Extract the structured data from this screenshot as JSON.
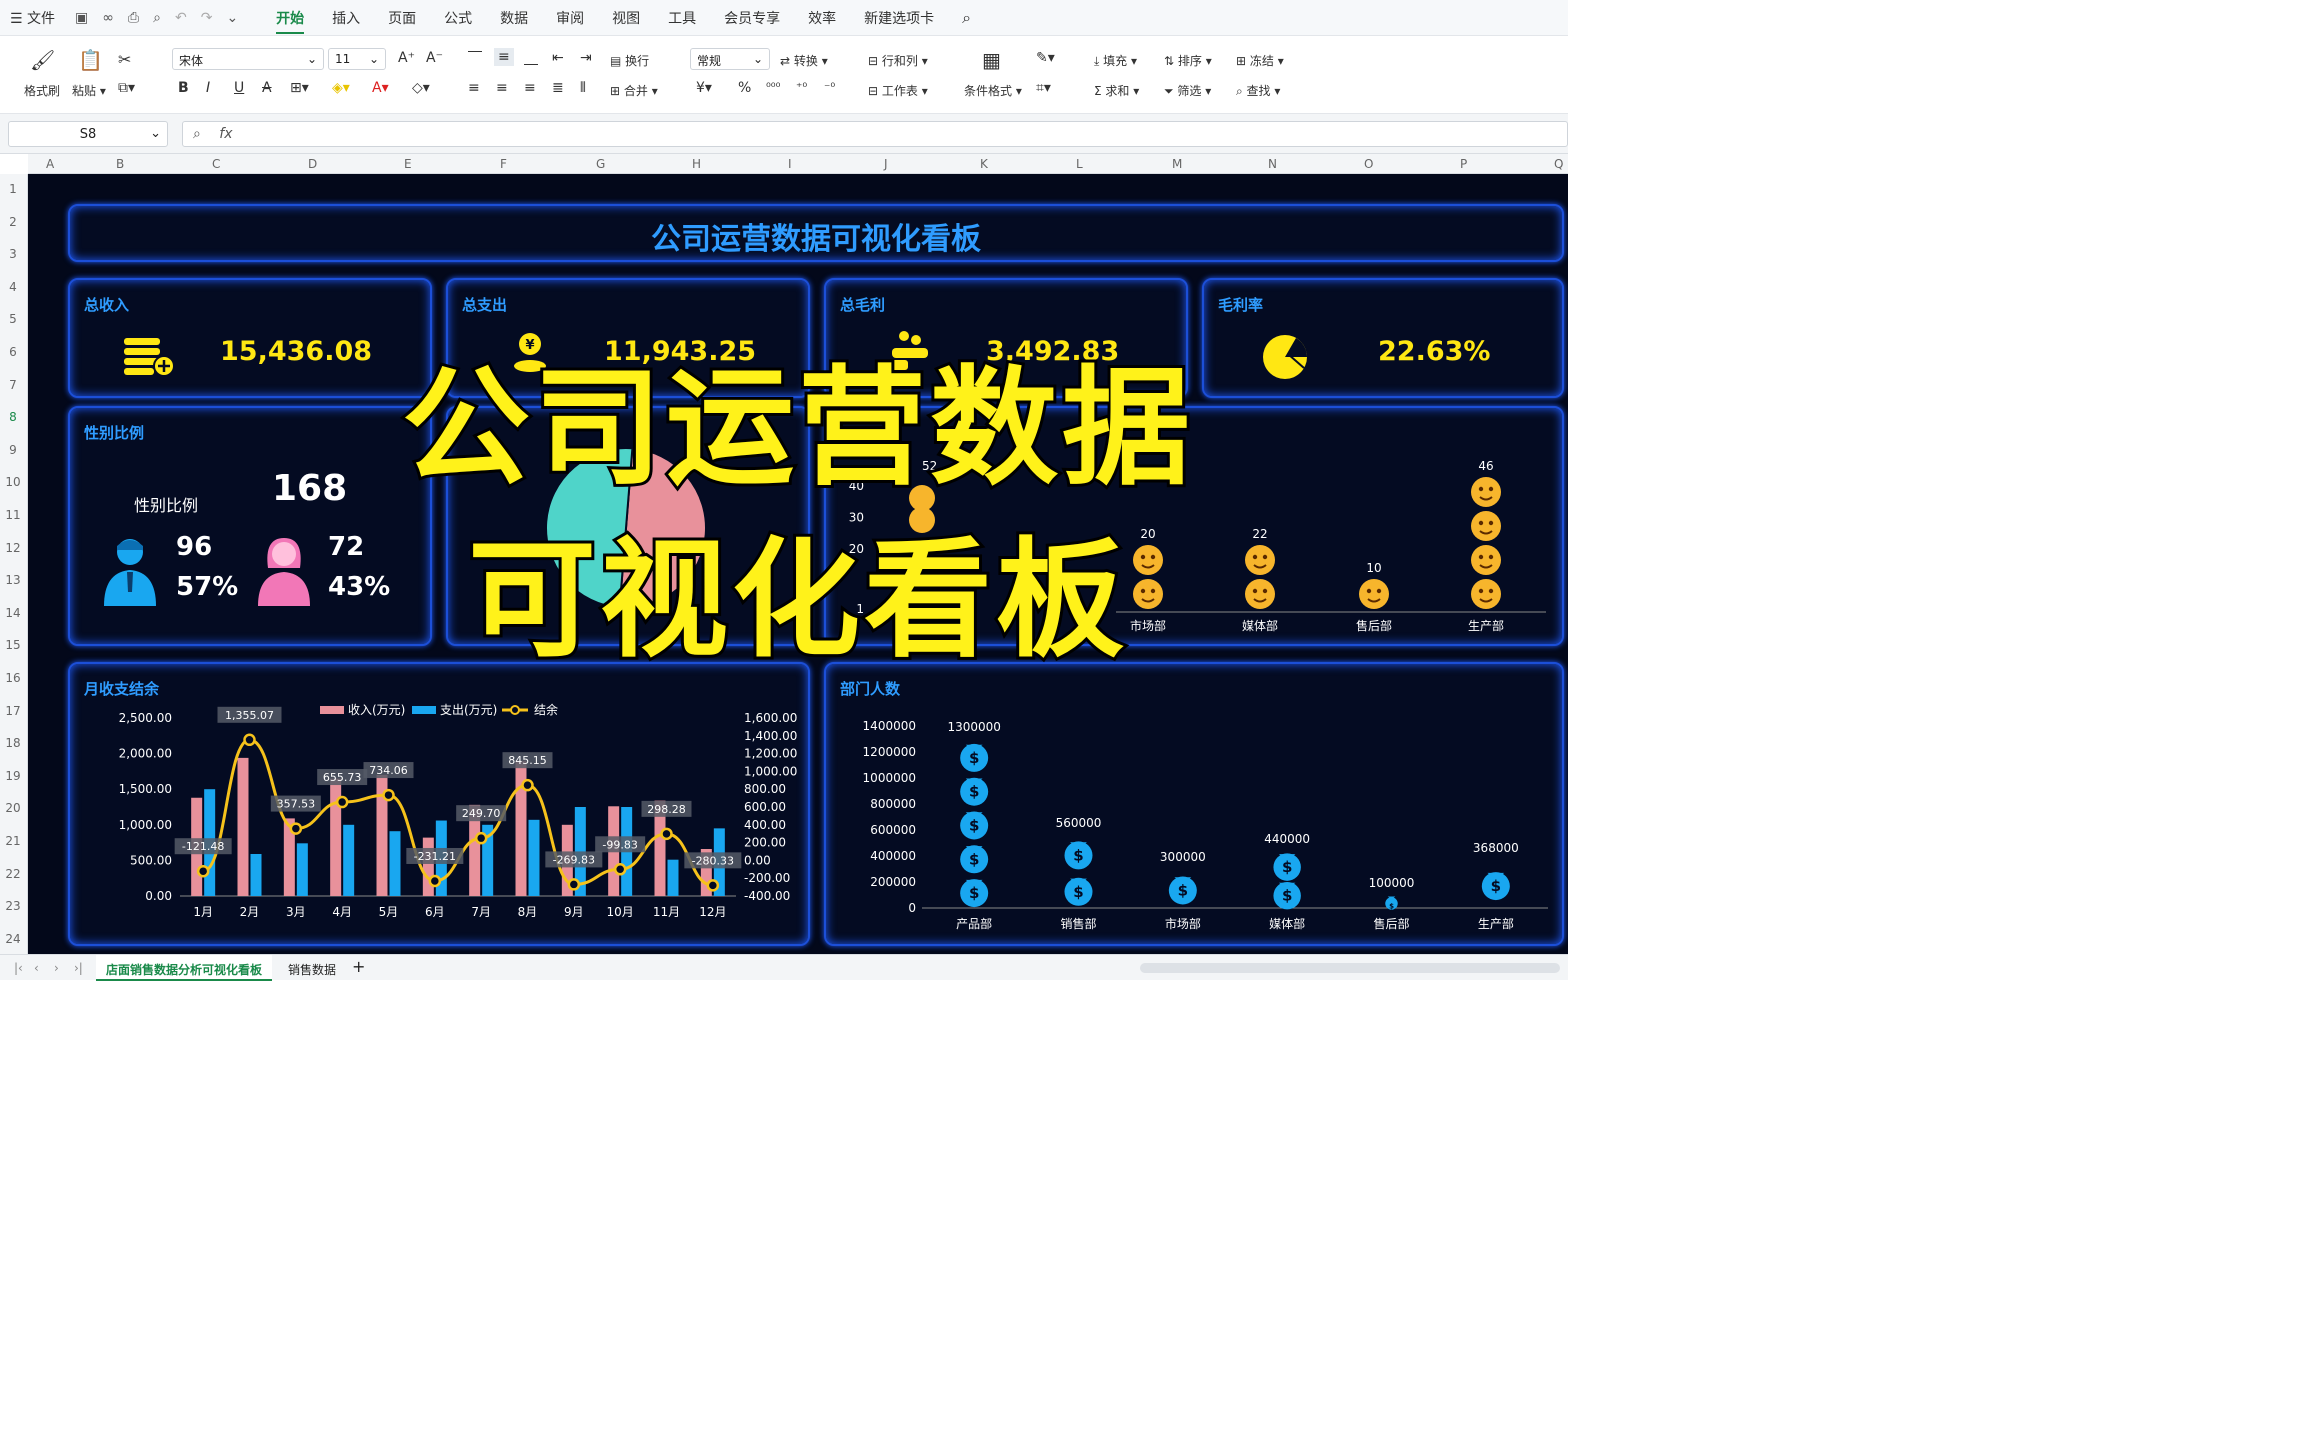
{
  "menu": {
    "file": "文件",
    "tabs": [
      "开始",
      "插入",
      "页面",
      "公式",
      "数据",
      "审阅",
      "视图",
      "工具",
      "会员专享",
      "效率",
      "新建选项卡"
    ],
    "active_index": 0
  },
  "ribbon": {
    "format_painter": "格式刷",
    "paste": "粘贴",
    "font_name": "宋体",
    "font_size": "11",
    "wrap": "换行",
    "merge": "合并",
    "number_format": "常规",
    "convert": "转换",
    "row_col": "行和列",
    "worksheet": "工作表",
    "cond_format": "条件格式",
    "fill": "填充",
    "sort": "排序",
    "freeze": "冻结",
    "sum": "求和",
    "filter": "筛选",
    "find": "查找"
  },
  "formula_bar": {
    "name_box": "S8",
    "fx": "fx",
    "value": ""
  },
  "columns": [
    "A",
    "B",
    "C",
    "D",
    "E",
    "F",
    "G",
    "H",
    "I",
    "J",
    "K",
    "L",
    "M",
    "N",
    "O",
    "P",
    "Q"
  ],
  "rows": [
    "1",
    "2",
    "3",
    "4",
    "5",
    "6",
    "7",
    "8",
    "9",
    "10",
    "11",
    "12",
    "13",
    "14",
    "15",
    "16",
    "17",
    "18",
    "19",
    "20",
    "21",
    "22",
    "23",
    "24"
  ],
  "dashboard": {
    "title": "公司运营数据可视化看板",
    "kpis": [
      {
        "label": "总收入",
        "value": "15,436.08",
        "icon": "coins-plus-icon"
      },
      {
        "label": "总支出",
        "value": "11,943.25",
        "icon": "yen-bag-icon"
      },
      {
        "label": "总毛利",
        "value": "3,492.83",
        "icon": "money-hand-icon"
      },
      {
        "label": "毛利率",
        "value": "22.63%",
        "icon": "pie-ratio-icon"
      }
    ],
    "gender": {
      "title": "性别比例",
      "subtitle": "性别比例",
      "total": "168",
      "male_count": "96",
      "male_pct": "57%",
      "female_count": "72",
      "female_pct": "43%"
    },
    "mid_panel_title": "",
    "dept_count_panel": {
      "title": "",
      "label_52": "52"
    }
  },
  "overlay": {
    "line1": "公司运营数据",
    "line2": "可视化看板"
  },
  "chart_data": [
    {
      "type": "bar",
      "title": "月收支结余",
      "categories": [
        "1月",
        "2月",
        "3月",
        "4月",
        "5月",
        "6月",
        "7月",
        "8月",
        "9月",
        "10月",
        "11月",
        "12月"
      ],
      "series": [
        {
          "name": "收入(万元)",
          "color": "#e8919b",
          "values": [
            1380,
            1940,
            1090,
            1650,
            1700,
            820,
            1280,
            1900,
            1000,
            1260,
            1340,
            660
          ]
        },
        {
          "name": "支出(万元)",
          "color": "#19a7f0",
          "values": [
            1500,
            590,
            740,
            1000,
            910,
            1060,
            1000,
            1070,
            1250,
            1250,
            510,
            950
          ]
        },
        {
          "name": "结余",
          "color": "#f6c21b",
          "type": "line",
          "values": [
            -121.48,
            1355.07,
            357.53,
            655.73,
            734.06,
            -231.21,
            249.7,
            845.15,
            -269.83,
            -99.83,
            298.28,
            -280.33
          ]
        }
      ],
      "balance_labels": [
        "-121.48",
        "1,355.07",
        "357.53",
        "655.73",
        "734.06",
        "-231.21",
        "249.70",
        "845.15",
        "-269.83",
        "-99.83",
        "298.28",
        "-280.33"
      ],
      "yleft": {
        "ticks": [
          "0.00",
          "500.00",
          "1,000.00",
          "1,500.00",
          "2,000.00",
          "2,500.00"
        ],
        "range": [
          0,
          2500
        ]
      },
      "yright": {
        "ticks": [
          "-400.00",
          "-200.00",
          "0.00",
          "200.00",
          "400.00",
          "600.00",
          "800.00",
          "1,000.00",
          "1,200.00",
          "1,400.00",
          "1,600.00"
        ],
        "range": [
          -400,
          1600
        ]
      }
    },
    {
      "type": "bar",
      "title": "部门人数",
      "categories": [
        "产品部",
        "销售部",
        "市场部",
        "媒体部",
        "售后部",
        "生产部"
      ],
      "values": [
        1300000,
        560000,
        300000,
        440000,
        100000,
        368000
      ],
      "value_labels": [
        "1300000",
        "560000",
        "300000",
        "440000",
        "100000",
        "368000"
      ],
      "yticks": [
        "0",
        "200000",
        "400000",
        "600000",
        "800000",
        "1000000",
        "1200000",
        "1400000"
      ],
      "ylim": [
        0,
        1400000
      ],
      "marker_icon": "money-bag-icon",
      "color": "#19a7f0"
    },
    {
      "type": "bar",
      "title": "",
      "categories": [
        "市场部",
        "媒体部",
        "售后部",
        "生产部"
      ],
      "values": [
        20,
        22,
        10,
        46
      ],
      "value_labels": [
        "20",
        "22",
        "10",
        "46"
      ],
      "yticks": [
        "1",
        "20",
        "30",
        "40"
      ],
      "marker_icon": "emoji-face-icon",
      "color": "#f7b52c"
    },
    {
      "type": "pie",
      "title": "",
      "slices": [
        {
          "value": 50,
          "color": "#e8919b"
        },
        {
          "value": 50,
          "color": "#4fd4c9"
        }
      ]
    }
  ],
  "sheet_tabs": [
    "店面销售数据分析可视化看板",
    "销售数据"
  ],
  "colors": {
    "panel_border": "#1c4fd8",
    "title_blue": "#2f9cff",
    "kpi_yellow": "#ffe713",
    "background": "#03081a"
  }
}
